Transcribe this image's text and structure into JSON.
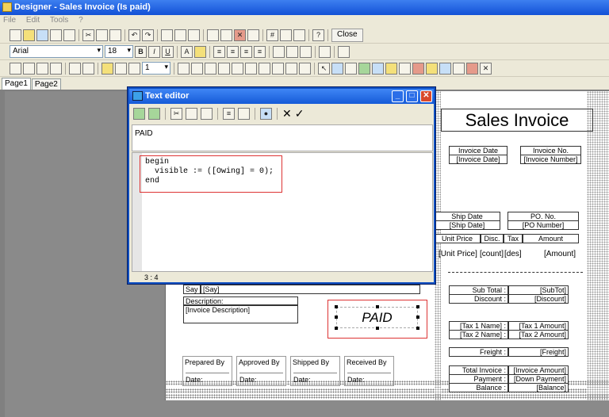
{
  "window": {
    "title": "Designer - Sales Invoice (Is paid)"
  },
  "menu": [
    "File",
    "Edit",
    "Tools",
    "?"
  ],
  "toolbar": {
    "close_label": "Close",
    "font_name": "Arial",
    "font_size": "18",
    "line_width": "1"
  },
  "tabs": [
    "Page1",
    "Page2"
  ],
  "report": {
    "title": "Sales Invoice",
    "invoice_date_label": "Invoice Date",
    "invoice_date_field": "[Invoice Date]",
    "invoice_no_label": "Invoice No.",
    "invoice_no_field": "[Invoice Number]",
    "ship_date_label": "Ship Date",
    "ship_date_field": "[Ship Date]",
    "po_label": "PO. No.",
    "po_field": "[PO Number]",
    "col_unit_price": "Unit Price",
    "col_disc": "Disc.",
    "col_tax": "Tax",
    "col_amount": "Amount",
    "row_unit_price": "[Unit Price]",
    "row_count": "[count]",
    "row_des": "[des]",
    "row_amount": "[Amount]",
    "say_label": "Say",
    "say_field": "[Say]",
    "description_label": "Description:",
    "description_field": "[Invoice Description]",
    "paid_text": "PAID",
    "subtotal_label": "Sub Total :",
    "subtotal_field": "[SubTot]",
    "discount_label": "Discount :",
    "discount_field": "[Discount]",
    "tax1_label": "[Tax 1 Name] :",
    "tax1_field": "[Tax 1 Amount]",
    "tax2_label": "[Tax 2 Name] :",
    "tax2_field": "[Tax 2 Amount]",
    "freight_label": "Freight :",
    "freight_field": "[Freight]",
    "total_label": "Total Invoice :",
    "total_field": "[Invoice Amount]",
    "payment_label": "Payment :",
    "payment_field": "[Down Payment]",
    "balance_label": "Balance :",
    "balance_field": "[Balance]",
    "signatures": [
      {
        "label": "Prepared By",
        "date": "Date:"
      },
      {
        "label": "Approved By",
        "date": "Date:"
      },
      {
        "label": "Shipped By",
        "date": "Date:"
      },
      {
        "label": "Received By",
        "date": "Date:"
      }
    ]
  },
  "dialog": {
    "title": "Text editor",
    "name": "PAID",
    "code": "begin\n  visible := ([Owing] = 0);\nend",
    "status": "3 : 4"
  }
}
